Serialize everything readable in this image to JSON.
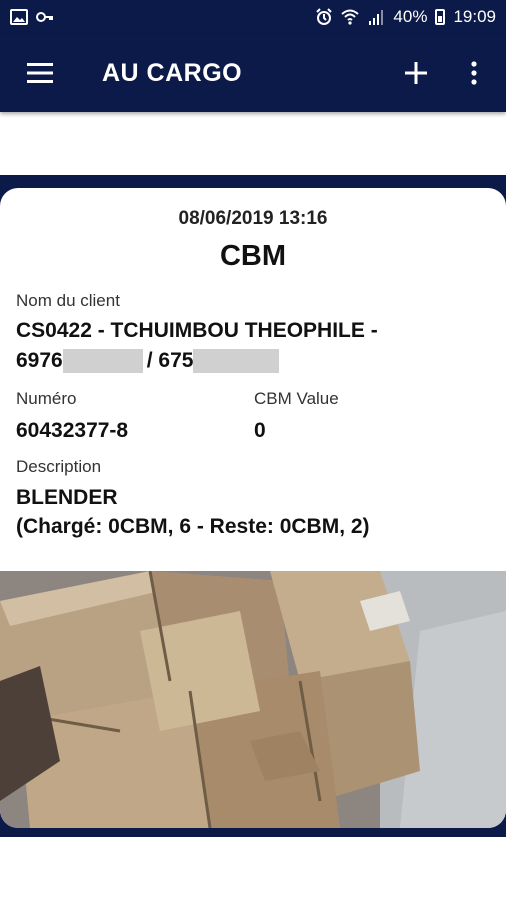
{
  "status_bar": {
    "battery": "40%",
    "time": "19:09"
  },
  "app_bar": {
    "title": "AU CARGO",
    "icons": [
      "menu-icon",
      "add-icon",
      "more-vert-icon"
    ]
  },
  "colors": {
    "primary": "#0c1a4a",
    "card": "#ffffff"
  },
  "record": {
    "datetime": "08/06/2019 13:16",
    "type": "CBM",
    "client_label": "Nom du client",
    "client_line1": "CS0422 - TCHUIMBOU THEOPHILE -",
    "client_phone1_prefix": "6976",
    "client_separator": "/ 675",
    "numero_label": "Numéro",
    "numero_value": "60432377-8",
    "cbm_label": "CBM Value",
    "cbm_value": "0",
    "description_label": "Description",
    "description_line1": "BLENDER",
    "description_line2": "(Chargé: 0CBM, 6 - Reste: 0CBM, 2)"
  },
  "photo": {
    "subject": "cardboard-boxes-photo"
  }
}
